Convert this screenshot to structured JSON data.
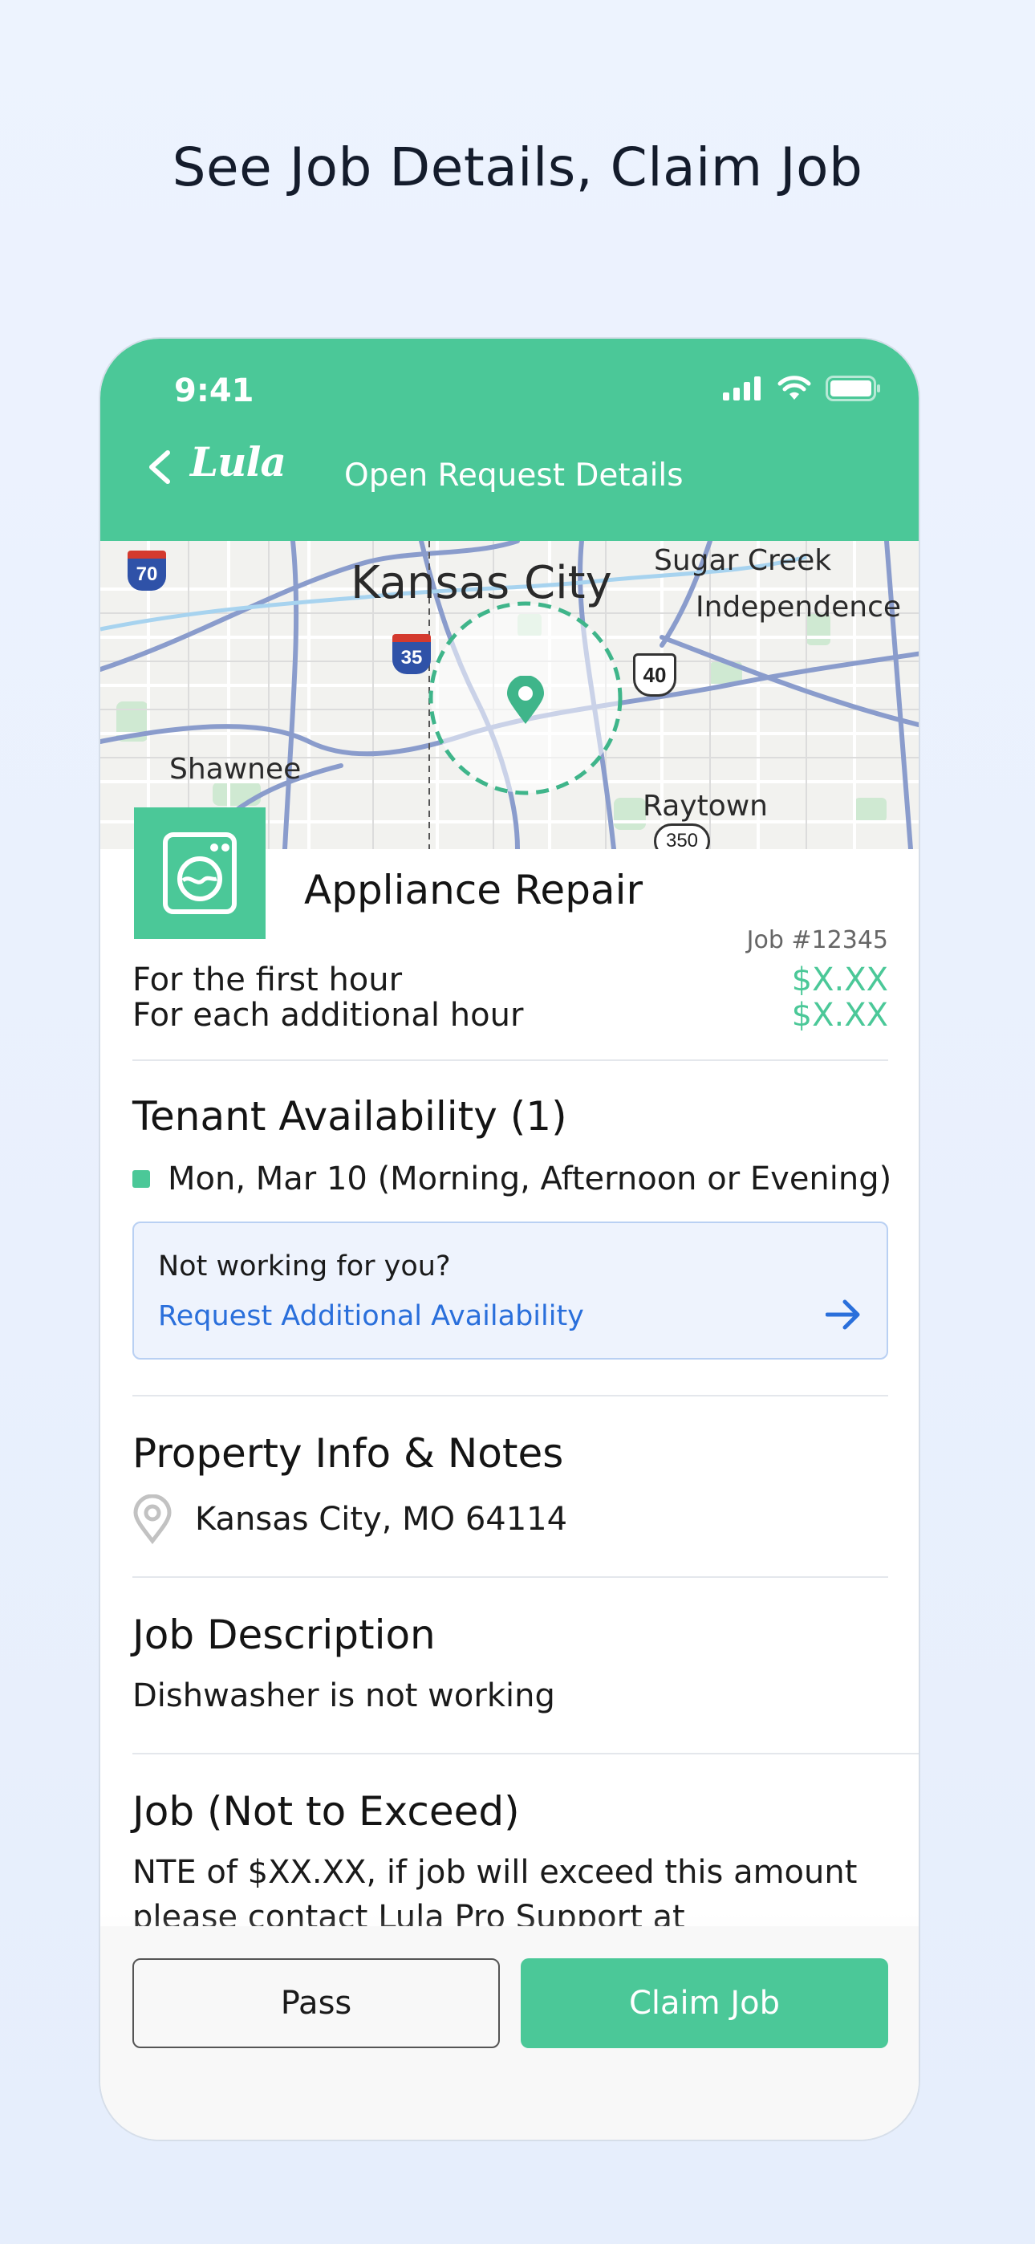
{
  "headline": "See Job Details, Claim Job",
  "status_bar": {
    "time": "9:41"
  },
  "nav": {
    "logo": "Lula",
    "title": "Open Request Details"
  },
  "map": {
    "labels": {
      "kansas_city": "Kansas City",
      "sugar_creek": "Sugar Creek",
      "independence": "Independence",
      "shawnee": "Shawnee",
      "raytown": "Raytown"
    },
    "shields": {
      "i70": "70",
      "i35": "35",
      "us40": "40",
      "r350": "350"
    }
  },
  "job": {
    "service": "Appliance Repair",
    "number": "Job #12345",
    "rates": [
      {
        "label": "For the first hour",
        "price": "$X.XX"
      },
      {
        "label": "For each additional hour",
        "price": "$X.XX"
      }
    ]
  },
  "availability": {
    "title": "Tenant Availability (1)",
    "slot": "Mon, Mar 10 (Morning, Afternoon or Evening)",
    "prompt": "Not working for you?",
    "link": "Request Additional Availability"
  },
  "property": {
    "title": "Property Info & Notes",
    "address": "Kansas City, MO 64114"
  },
  "description": {
    "title": "Job Description",
    "text": "Dishwasher is not working"
  },
  "nte": {
    "title": "Job (Not to Exceed)",
    "line1": "NTE of $XX.XX, if job will exceed this amount",
    "line2": "please contact Lula Pro Support at"
  },
  "actions": {
    "pass": "Pass",
    "claim": "Claim Job"
  },
  "colors": {
    "brand_green": "#4bc898",
    "link_blue": "#2a6fdb"
  }
}
